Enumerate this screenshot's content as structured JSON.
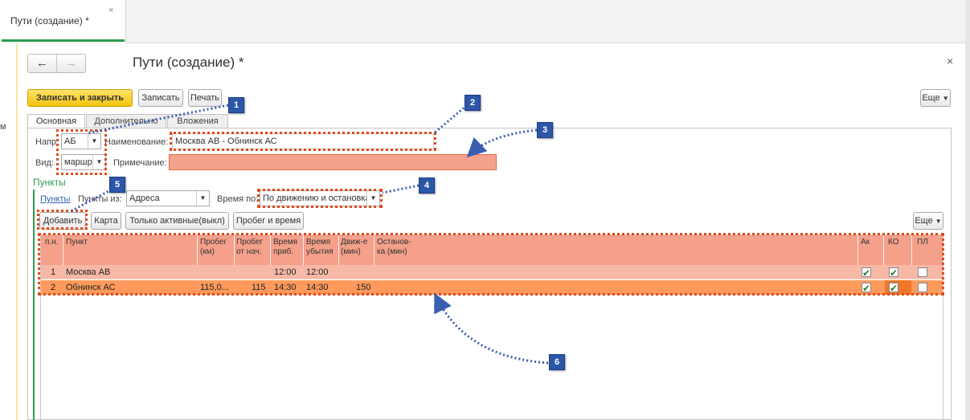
{
  "tabstrip": {
    "tab_label": "Пути (создание) *",
    "tab_close": "×"
  },
  "left": {
    "mark": "м"
  },
  "form": {
    "title": "Пути (создание) *",
    "close": "×",
    "nav_back": "🡐",
    "nav_forward": "🡒"
  },
  "toolbar": {
    "save_close": "Записать и закрыть",
    "save": "Записать",
    "print": "Печать",
    "more": "Еще"
  },
  "tabs": [
    "Основная",
    "Дополнительно",
    "Вложения"
  ],
  "fields": {
    "direction_label": "Напр:",
    "direction_value": "АБ",
    "name_label": "Наименование:",
    "name_value": "Москва АВ - Обнинск АС",
    "type_label": "Вид:",
    "type_value": "маршр",
    "note_label": "Примечание:",
    "note_value": ""
  },
  "points": {
    "section_title": "Пункты",
    "link": "Пункты",
    "from_label": "Пункты из:",
    "from_value": "Адреса",
    "time_label": "Время по:",
    "time_value": "По движению и остановкам",
    "add": "Добавить",
    "map": "Карта",
    "only_active": "Только активные(выкл)",
    "mileage_time": "Пробег и время",
    "more": "Еще"
  },
  "grid": {
    "headers": {
      "pn": "п.н.",
      "punkt": "Пункт",
      "km": "Пробег (км)",
      "from_start": "Пробег от нач.",
      "arr": "Время приб.",
      "dep": "Время убытия",
      "move": "Движ-е (мин)",
      "stop": "Останов-ка (мин)",
      "ak": "Ак",
      "ko": "КО",
      "pl": "ПЛ"
    },
    "rows": [
      {
        "pn": "1",
        "punkt": "Москва АВ",
        "km": "",
        "from_start": "",
        "arr": "12:00",
        "dep": "12:00",
        "move": "",
        "ak": true,
        "ko": true,
        "pl": false
      },
      {
        "pn": "2",
        "punkt": "Обнинск АС",
        "km": "115,0...",
        "from_start": "115",
        "arr": "14:30",
        "dep": "14:30",
        "move": "150",
        "ak": true,
        "ko": true,
        "pl": false
      }
    ]
  },
  "annotations": [
    "1",
    "2",
    "3",
    "4",
    "5",
    "6"
  ],
  "colors": {
    "accent_green": "#2e9b4e",
    "annotation_red": "#e04a1a",
    "badge_blue": "#2c56a8",
    "highlight": "#f4a08a"
  }
}
